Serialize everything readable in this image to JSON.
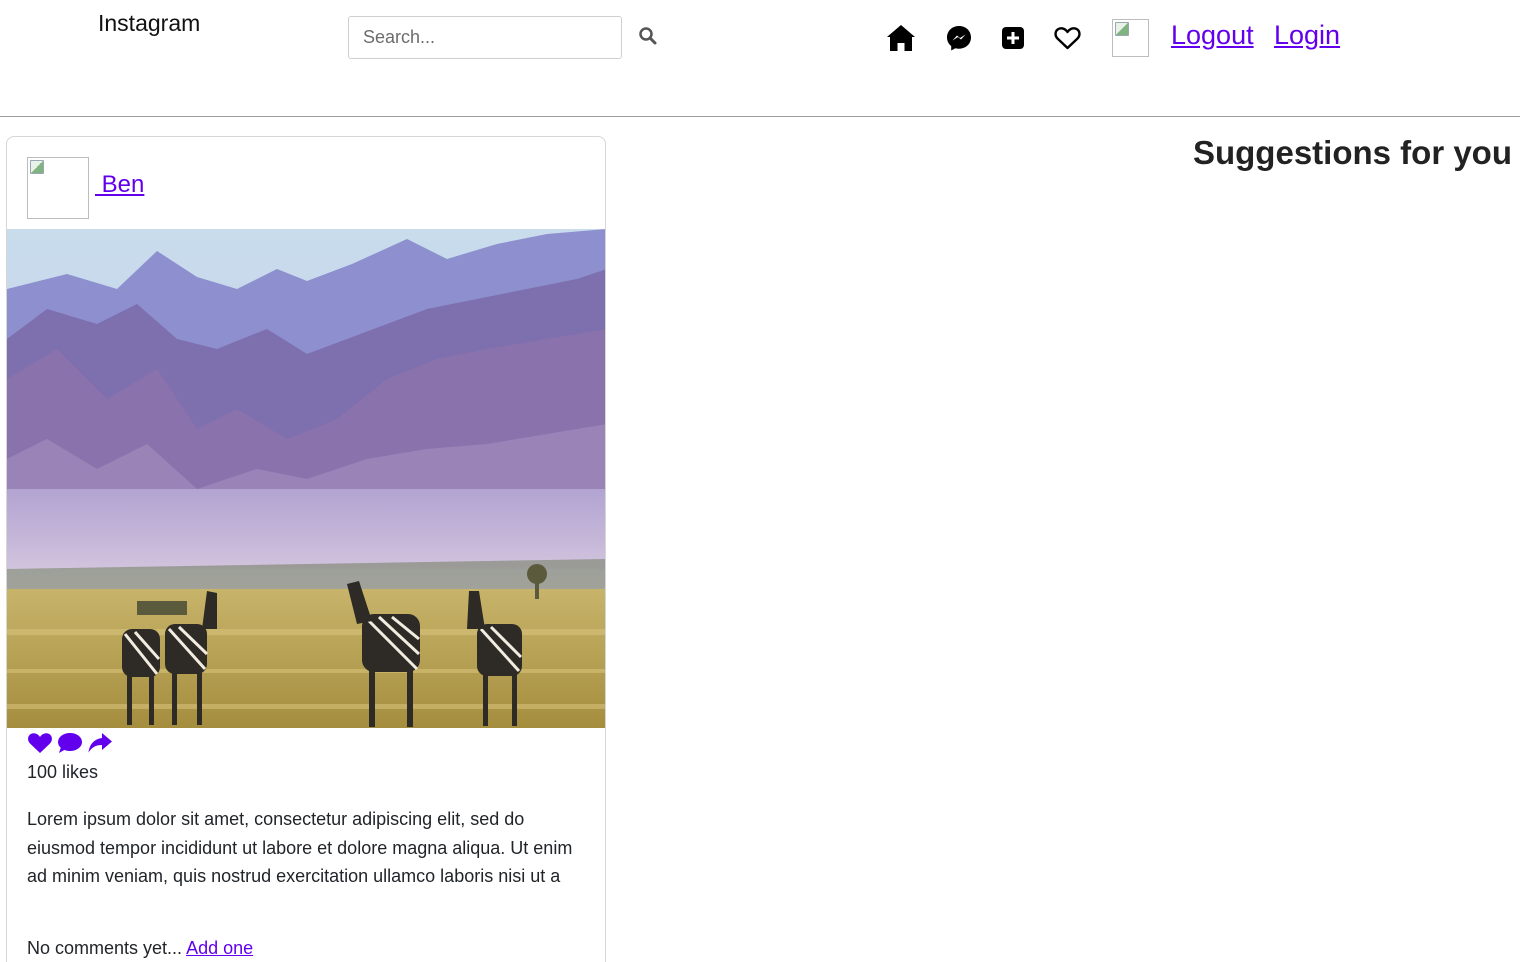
{
  "navbar": {
    "brand": "Instagram",
    "search_placeholder": "Search...",
    "icons": [
      "home-icon",
      "messenger-icon",
      "add-post-icon",
      "heart-icon"
    ],
    "logout_label": "Logout",
    "login_label": "Login"
  },
  "post": {
    "username": " Ben",
    "likes": "100 likes",
    "caption": "Lorem ipsum dolor sit amet, consectetur adipiscing elit, sed do eiusmod tempor incididunt ut labore et dolore magna aliqua. Ut enim ad minim veniam, quis nostrud exercitation ullamco laboris nisi ut a",
    "no_comments_text": "No comments yet... ",
    "add_comment_link": "Add one",
    "action_icons": [
      "like-icon",
      "comment-icon",
      "share-icon"
    ]
  },
  "sidebar": {
    "suggestions_title": "Suggestions for you"
  },
  "colors": {
    "accent": "#6200ee",
    "link": "#6200ee",
    "divider": "#9e9e9e"
  }
}
